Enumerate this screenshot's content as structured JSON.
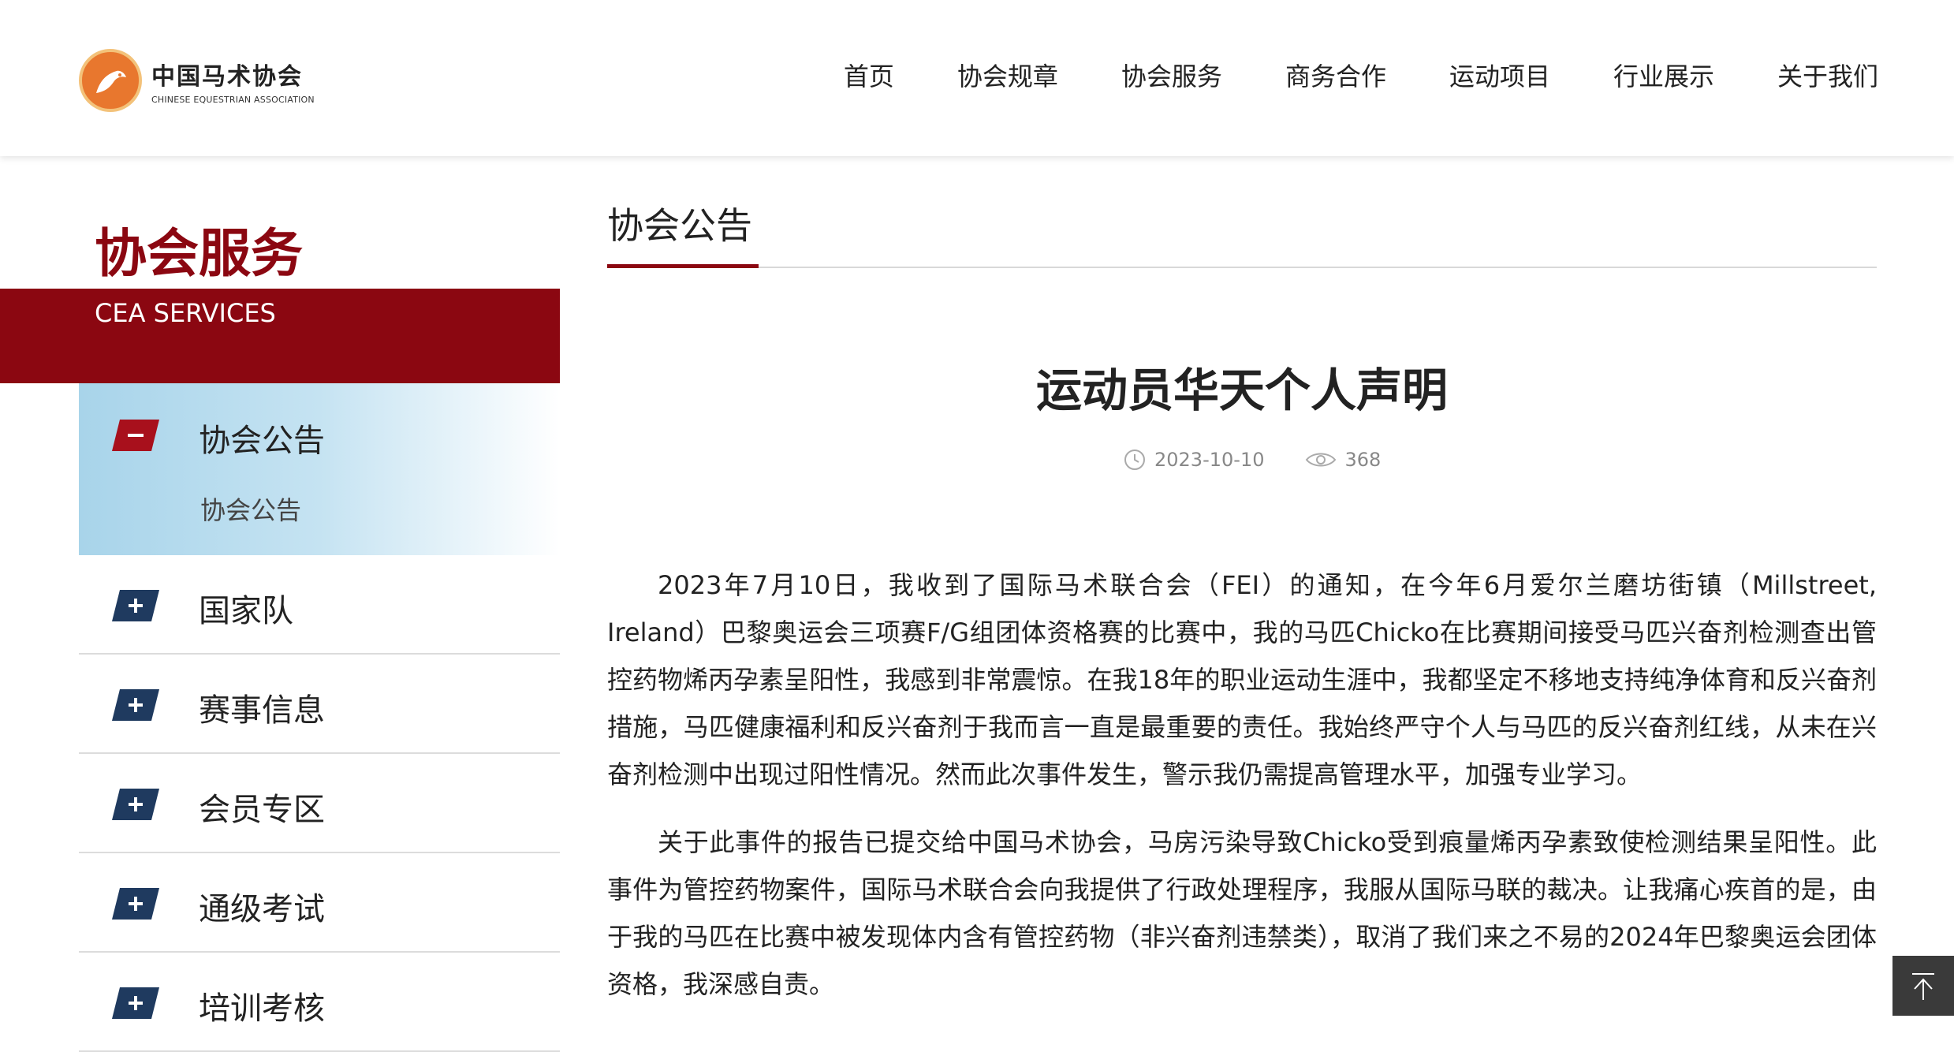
{
  "header": {
    "logo_cn": "中国马术协会",
    "logo_en": "CHINESE EQUESTRIAN ASSOCIATION",
    "nav": [
      "首页",
      "协会规章",
      "协会服务",
      "商务合作",
      "运动项目",
      "行业展示",
      "关于我们"
    ]
  },
  "sidebar": {
    "title": "协会服务",
    "subtitle": "CEA SERVICES",
    "active": {
      "label": "协会公告",
      "sub": "协会公告",
      "icon": "minus-icon"
    },
    "items": [
      {
        "label": "国家队",
        "icon": "plus-icon"
      },
      {
        "label": "赛事信息",
        "icon": "plus-icon"
      },
      {
        "label": "会员专区",
        "icon": "plus-icon"
      },
      {
        "label": "通级考试",
        "icon": "plus-icon"
      },
      {
        "label": "培训考核",
        "icon": "plus-icon"
      }
    ]
  },
  "content": {
    "section": "协会公告",
    "title": "运动员华天个人声明",
    "date": "2023-10-10",
    "views": "368",
    "paragraphs": [
      "2023年7月10日，我收到了国际马术联合会（FEI）的通知，在今年6月爱尔兰磨坊街镇（Millstreet, Ireland）巴黎奥运会三项赛F/G组团体资格赛的比赛中，我的马匹Chicko在比赛期间接受马匹兴奋剂检测查出管控药物烯丙孕素呈阳性，我感到非常震惊。在我18年的职业运动生涯中，我都坚定不移地支持纯净体育和反兴奋剂措施，马匹健康福利和反兴奋剂于我而言一直是最重要的责任。我始终严守个人与马匹的反兴奋剂红线，从未在兴奋剂检测中出现过阳性情况。然而此次事件发生，警示我仍需提高管理水平，加强专业学习。",
      "关于此事件的报告已提交给中国马术协会，马房污染导致Chicko受到痕量烯丙孕素致使检测结果呈阳性。此事件为管控药物案件，国际马术联合会向我提供了行政处理程序，我服从国际马联的裁决。让我痛心疾首的是，由于我的马匹在比赛中被发现体内含有管控药物（非兴奋剂违禁类），取消了我们来之不易的2024年巴黎奥运会团体资格，我深感自责。"
    ]
  },
  "colors": {
    "brand_red": "#8b0711",
    "icon_navy": "#1f3a5f"
  }
}
